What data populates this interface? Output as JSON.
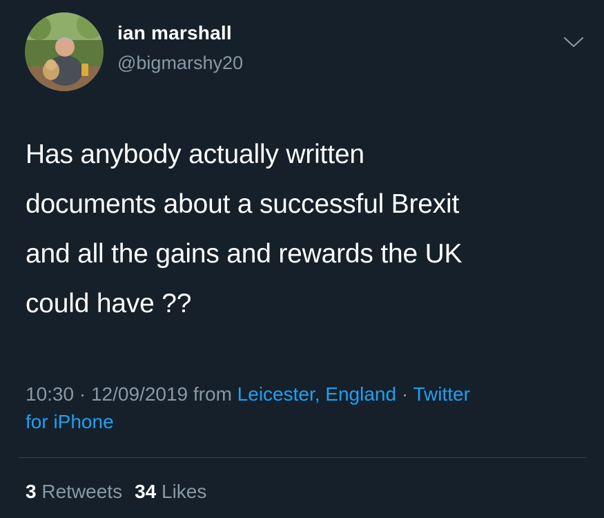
{
  "user": {
    "display_name": "ian marshall",
    "handle": "@bigmarshy20",
    "avatar_icon": "profile-photo-man-with-dog"
  },
  "menu": {
    "icon": "chevron-down-icon"
  },
  "tweet": {
    "lines": [
      "Has anybody actually written",
      "documents about a successful Brexit",
      "and all the gains and rewards the UK",
      "could have ??"
    ]
  },
  "meta": {
    "time": "10:30",
    "separator": " · ",
    "date": "12/09/2019",
    "from_label": " from ",
    "location": "Leicester, England",
    "source_line1": "Twitter",
    "source_line2": "for iPhone"
  },
  "stats": {
    "retweets_count": "3",
    "retweets_label": "Retweets",
    "likes_count": "34",
    "likes_label": "Likes"
  },
  "colors": {
    "background": "#15202b",
    "text": "#ffffff",
    "secondary": "#8899a6",
    "link": "#1da1f2",
    "divider": "#38444d"
  }
}
